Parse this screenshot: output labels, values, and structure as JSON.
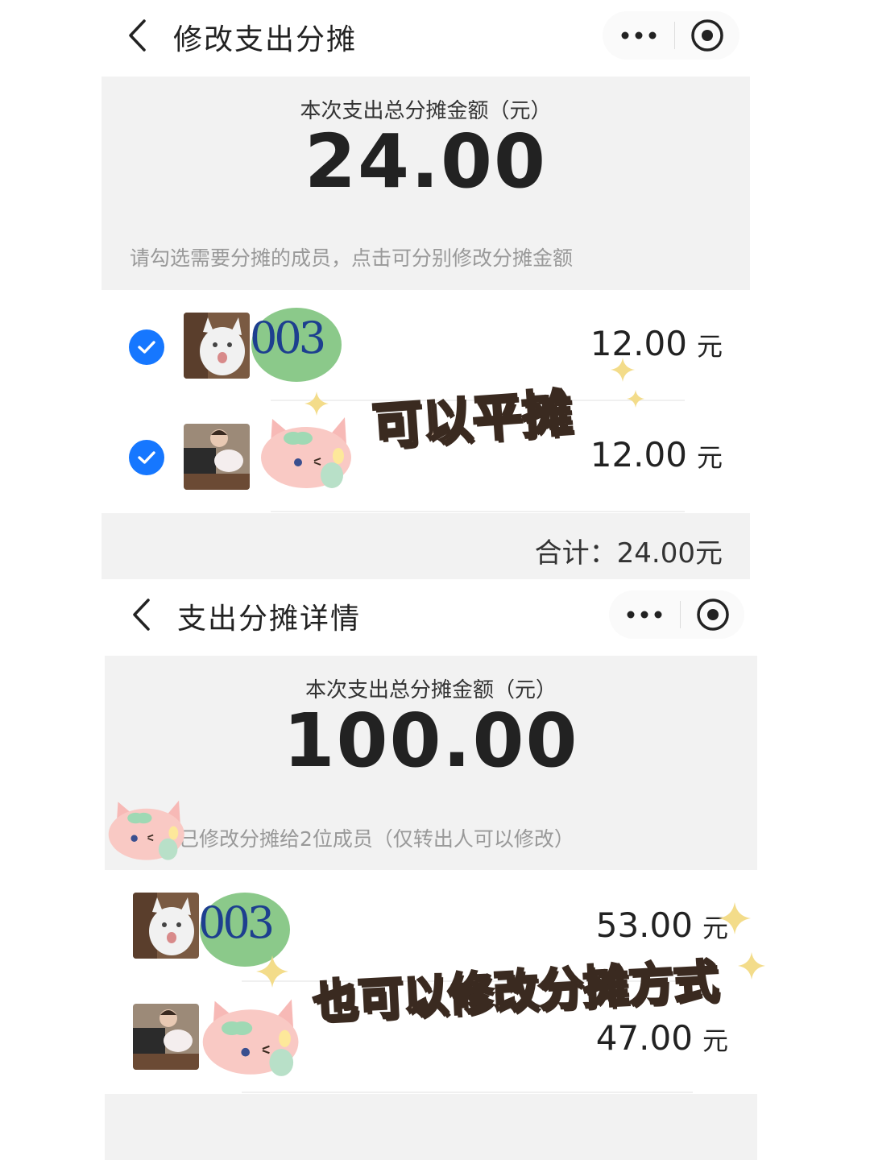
{
  "screen1": {
    "nav_title": "修改支出分摊",
    "total_label": "本次支出总分摊金额（元）",
    "total_value": "24.00",
    "hint": "请勾选需要分摊的成员，点击可分别修改分摊金额",
    "members": [
      {
        "amount": "12.00",
        "unit": "元",
        "checked": true
      },
      {
        "amount": "12.00",
        "unit": "元",
        "checked": true
      }
    ],
    "sum_text": "合计：24.00元",
    "overlay_caption": "可以平摊",
    "deco_name": "003"
  },
  "screen2": {
    "nav_title": "支出分摊详情",
    "total_label": "本次支出总分摊金额（元）",
    "total_value": "100.00",
    "hint": "已修改分摊给2位成员（仅转出人可以修改）",
    "members": [
      {
        "amount": "53.00",
        "unit": "元"
      },
      {
        "amount": "47.00",
        "unit": "元"
      }
    ],
    "overlay_caption": "也可以修改分摊方式",
    "deco_name": "003"
  },
  "colors": {
    "check_blue": "#1677ff",
    "panel_gray": "#f2f2f2",
    "sticker_fill": "#fbe2c9",
    "sticker_outline": "#3a2a20"
  }
}
